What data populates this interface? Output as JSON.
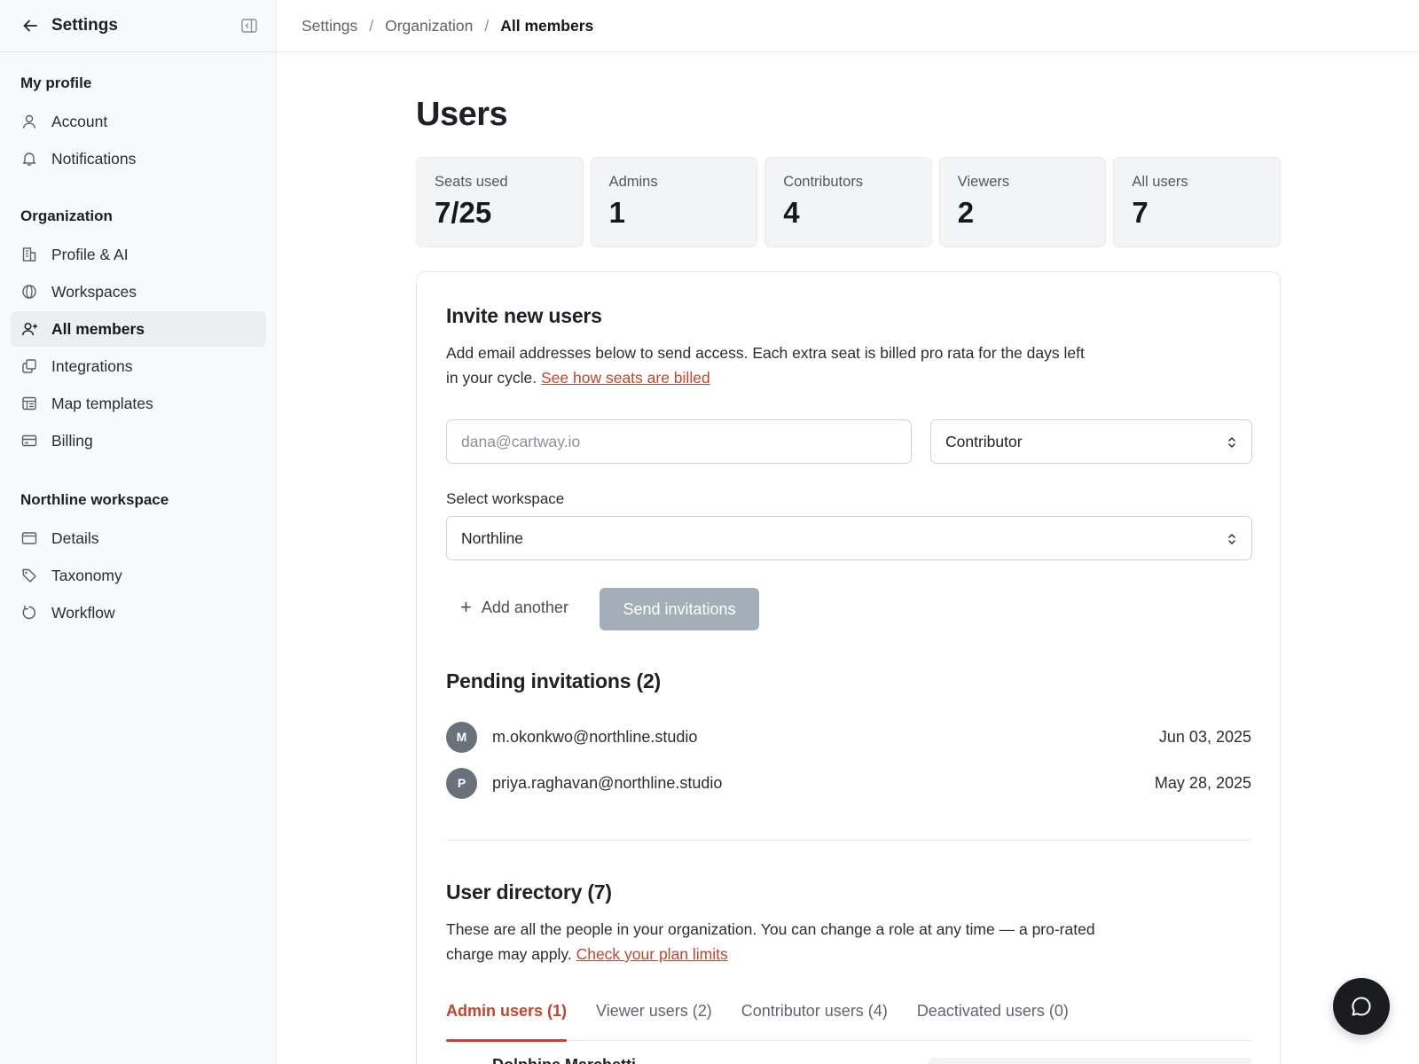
{
  "sidebar": {
    "title": "Settings",
    "sections": [
      {
        "heading": "My profile",
        "items": [
          {
            "label": "Account",
            "icon": "user-icon"
          },
          {
            "label": "Notifications",
            "icon": "bell-icon"
          }
        ]
      },
      {
        "heading": "Organization",
        "items": [
          {
            "label": "Profile & AI",
            "icon": "building-icon"
          },
          {
            "label": "Workspaces",
            "icon": "globe-icon"
          },
          {
            "label": "All members",
            "icon": "user-plus-icon",
            "active": true
          },
          {
            "label": "Integrations",
            "icon": "copy-icon"
          },
          {
            "label": "Map templates",
            "icon": "template-icon"
          },
          {
            "label": "Billing",
            "icon": "credit-card-icon"
          }
        ]
      },
      {
        "heading": "Northline workspace",
        "items": [
          {
            "label": "Details",
            "icon": "window-icon"
          },
          {
            "label": "Taxonomy",
            "icon": "tag-icon"
          },
          {
            "label": "Workflow",
            "icon": "refresh-icon"
          }
        ]
      }
    ]
  },
  "breadcrumb": [
    "Settings",
    "Organization",
    "All members"
  ],
  "page": {
    "title": "Users",
    "stats": [
      {
        "label": "Seats used",
        "value": "7/25"
      },
      {
        "label": "Admins",
        "value": "1"
      },
      {
        "label": "Contributors",
        "value": "4"
      },
      {
        "label": "Viewers",
        "value": "2"
      },
      {
        "label": "All users",
        "value": "7"
      }
    ]
  },
  "invite": {
    "title": "Invite new users",
    "description": "Add email addresses below to send access. Each extra seat is billed pro rata for the days left",
    "description_line2": "in your cycle.",
    "link": "See how seats are billed",
    "email_placeholder": "dana@cartway.io",
    "role_value": "Contributor",
    "workspace_label": "Select workspace",
    "workspace_value": "Northline",
    "add_another": "Add another",
    "send_button": "Send invitations"
  },
  "pending": {
    "title": "Pending invitations (2)",
    "rows": [
      {
        "initial": "M",
        "email": "m.okonkwo@northline.studio",
        "date": "Jun 03, 2025"
      },
      {
        "initial": "P",
        "email": "priya.raghavan@northline.studio",
        "date": "May 28, 2025"
      }
    ]
  },
  "directory": {
    "title": "User directory (7)",
    "description": "These are all the people in your organization. You can change a role at any time — a pro-rated",
    "description_line2": "charge may apply.",
    "link": "Check your plan limits",
    "tabs": [
      {
        "label": "Admin users (1)",
        "active": true
      },
      {
        "label": "Viewer users (2)"
      },
      {
        "label": "Contributor users (4)"
      },
      {
        "label": "Deactivated users (0)"
      }
    ],
    "first_row_name": "Dolphine Marchetti"
  },
  "colors": {
    "accent": "#c2452d",
    "send_disabled": "#a4aeb8",
    "sidebar_bg": "#f8f9fa",
    "active_nav_bg": "#eceef0",
    "stat_bg": "#f3f4f6",
    "avatar_bg": "#6b717a",
    "chat_bg": "#1a1c1f"
  }
}
